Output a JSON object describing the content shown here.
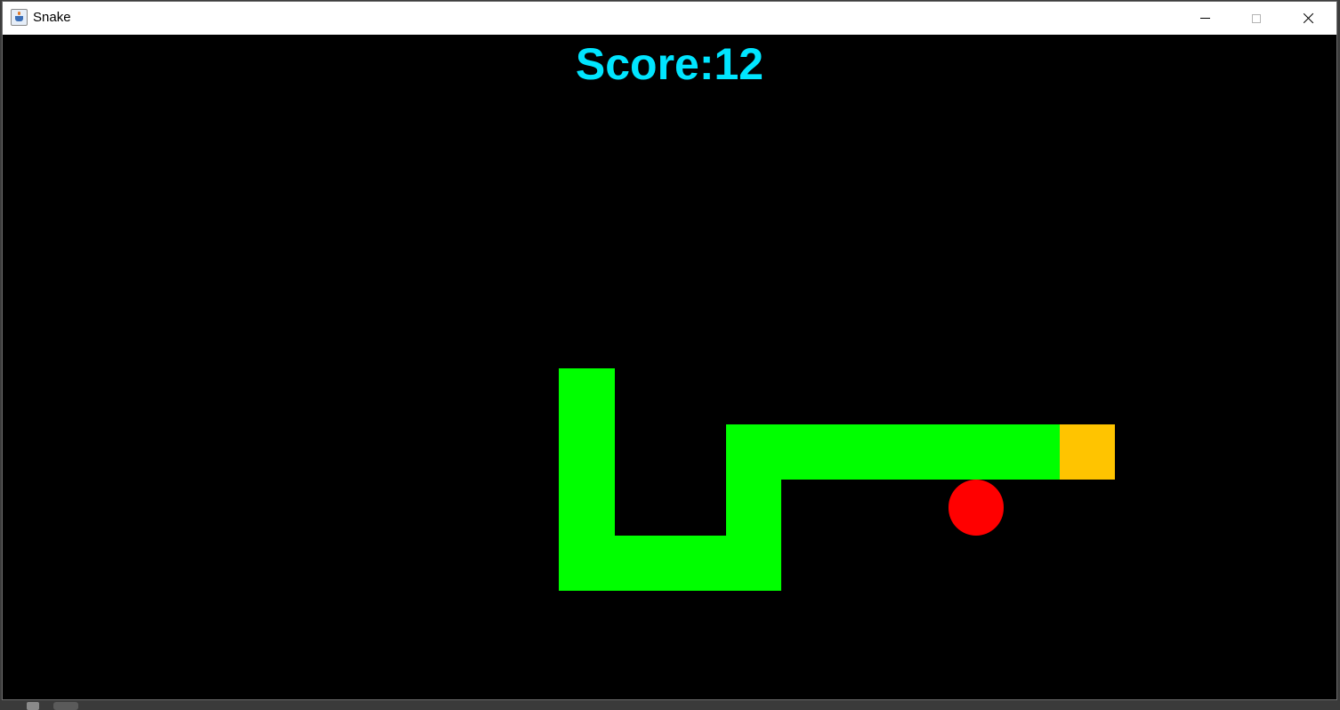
{
  "window": {
    "title": "Snake",
    "icon": "java-cup-icon"
  },
  "colors": {
    "background": "#000000",
    "score": "#00e5ff",
    "snake_body": "#00ff00",
    "snake_head": "#ffc400",
    "food": "#ff0000"
  },
  "game": {
    "score_text": "Score:12",
    "grid_cell_units": 1,
    "snake": {
      "direction": "right",
      "head": [
        19,
        7
      ],
      "body": [
        [
          18,
          7
        ],
        [
          17,
          7
        ],
        [
          16,
          7
        ],
        [
          15,
          7
        ],
        [
          14,
          7
        ],
        [
          13,
          7
        ],
        [
          13,
          8
        ],
        [
          13,
          9
        ],
        [
          12,
          9
        ],
        [
          11,
          9
        ],
        [
          10,
          9
        ],
        [
          10,
          8
        ],
        [
          10,
          7
        ],
        [
          10,
          6
        ]
      ]
    },
    "food": [
      17,
      8
    ]
  }
}
